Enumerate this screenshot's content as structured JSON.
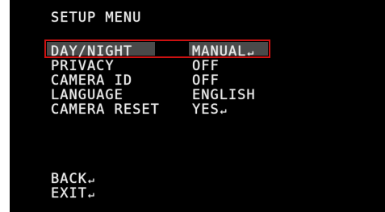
{
  "menu": {
    "title": "SETUP MENU",
    "items": [
      {
        "label": "DAY/NIGHT",
        "value": "MANUAL",
        "enter": "↵"
      },
      {
        "label": "PRIVACY",
        "value": "OFF",
        "enter": ""
      },
      {
        "label": "CAMERA ID",
        "value": "OFF",
        "enter": ""
      },
      {
        "label": "LANGUAGE",
        "value": "ENGLISH",
        "enter": ""
      },
      {
        "label": "CAMERA RESET",
        "value": "YES",
        "enter": "↵"
      }
    ],
    "back_label": "BACK",
    "exit_label": "EXIT",
    "enter_symbol": "↵"
  },
  "colors": {
    "background": "#000000",
    "text": "#e8e8e8",
    "selection_border": "#cc1111",
    "selection_fill": "#4a4a4a"
  },
  "selected_item": "DAY/NIGHT",
  "icons": [
    "enter-icon"
  ]
}
